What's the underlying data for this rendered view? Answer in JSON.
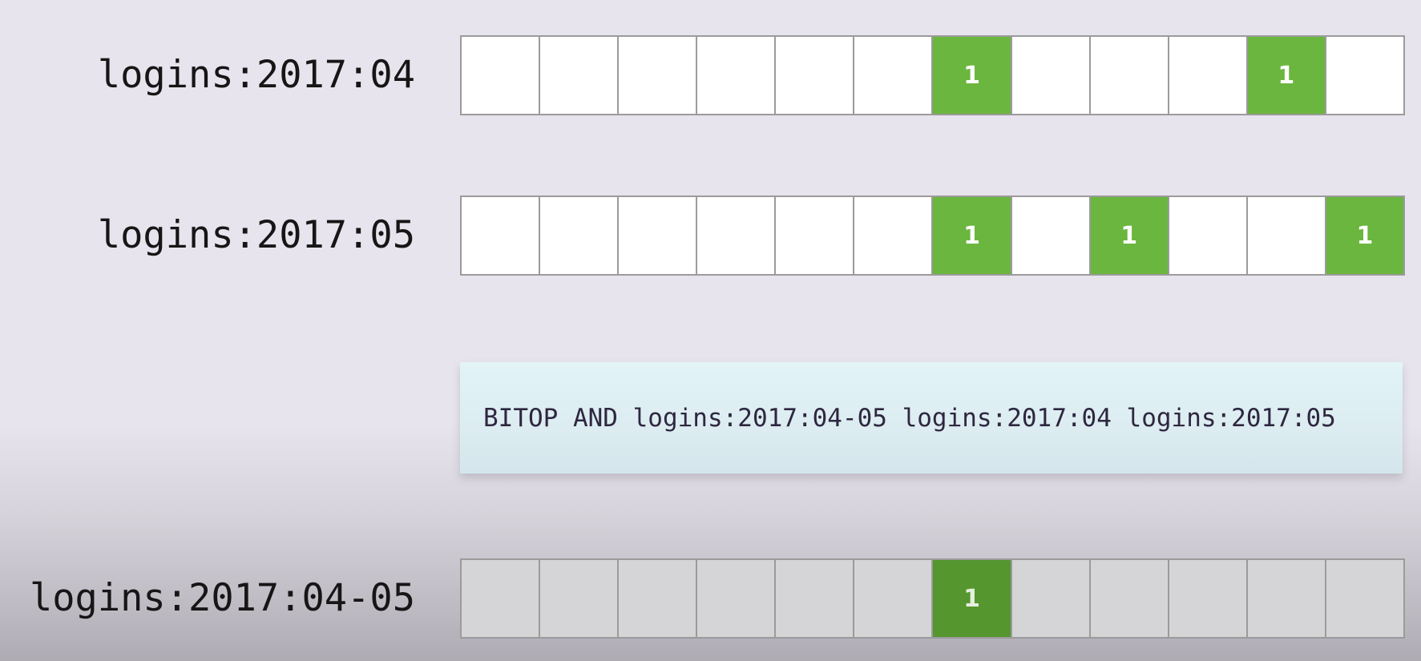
{
  "rows": [
    {
      "label": "logins:2017:04",
      "bits": [
        0,
        0,
        0,
        0,
        0,
        0,
        1,
        0,
        0,
        0,
        1,
        0
      ]
    },
    {
      "label": "logins:2017:05",
      "bits": [
        0,
        0,
        0,
        0,
        0,
        0,
        1,
        0,
        1,
        0,
        0,
        1
      ]
    }
  ],
  "command": "BITOP AND logins:2017:04-05 logins:2017:04 logins:2017:05",
  "result": {
    "label": "logins:2017:04-05",
    "bits": [
      0,
      0,
      0,
      0,
      0,
      0,
      1,
      0,
      0,
      0,
      0,
      0
    ]
  },
  "set_bit_text": "1",
  "colors": {
    "set_bit": "#6bb63e",
    "set_bit_result": "#55962f",
    "empty_bit": "#ffffff",
    "empty_bit_result": "#d5d5d7",
    "command_bg": "#e2f4f8"
  }
}
